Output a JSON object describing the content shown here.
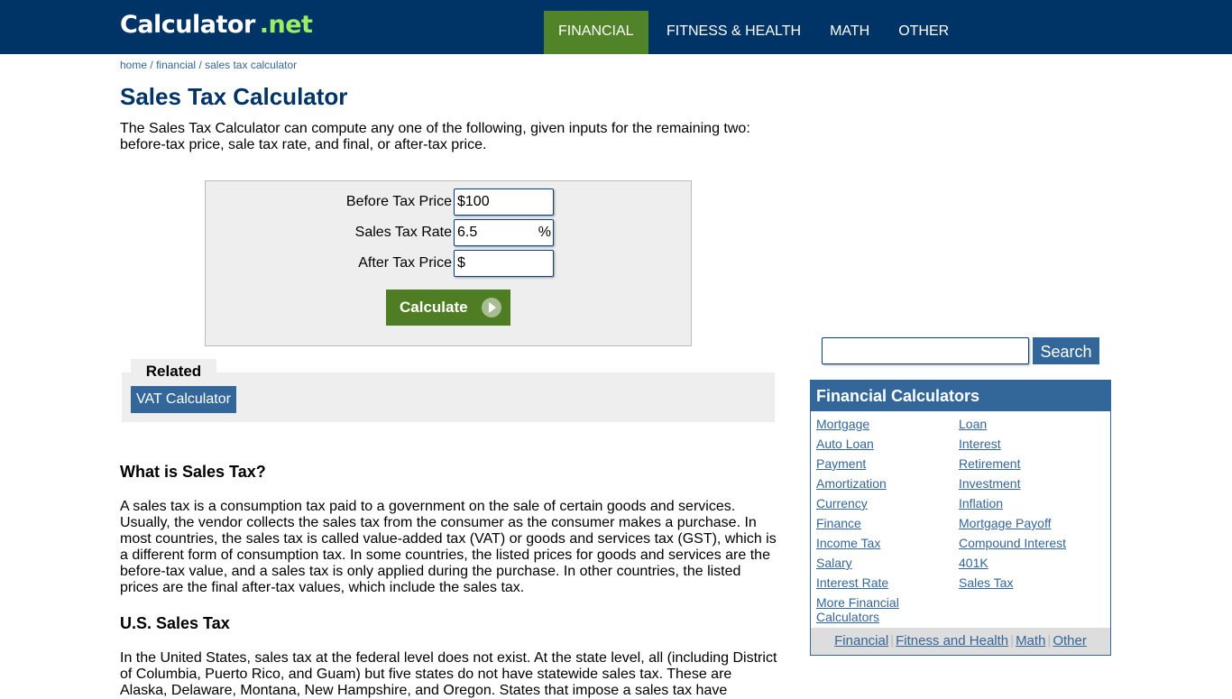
{
  "header": {
    "logo_main": "Calculator",
    "logo_suffix": ".net",
    "nav": [
      {
        "label": "FINANCIAL",
        "active": true
      },
      {
        "label": "FITNESS & HEALTH",
        "active": false
      },
      {
        "label": "MATH",
        "active": false
      },
      {
        "label": "OTHER",
        "active": false
      }
    ]
  },
  "breadcrumb": [
    "home",
    "financial",
    "sales tax calculator"
  ],
  "breadcrumb_sep": "/",
  "page": {
    "title": "Sales Tax Calculator",
    "intro": "The Sales Tax Calculator can compute any one of the following, given inputs for the remaining two: before-tax price, sale tax rate, and final, or after-tax price."
  },
  "calculator": {
    "fields": [
      {
        "label": "Before Tax Price",
        "value": "$100",
        "suffix": ""
      },
      {
        "label": "Sales Tax Rate",
        "value": "6.5",
        "suffix": "%"
      },
      {
        "label": "After Tax Price",
        "value": "$",
        "suffix": ""
      }
    ],
    "button_label": "Calculate"
  },
  "related": {
    "tab_label": "Related",
    "links": [
      "VAT Calculator"
    ]
  },
  "article": {
    "sections": [
      {
        "heading": "What is Sales Tax?",
        "text": "A sales tax is a consumption tax paid to a government on the sale of certain goods and services. Usually, the vendor collects the sales tax from the consumer as the consumer makes a purchase. In most countries, the sales tax is called value-added tax (VAT) or goods and services tax (GST), which is a different form of consumption tax. In some countries, the listed prices for goods and services are the before-tax value, and a sales tax is only applied during the purchase. In other countries, the listed prices are the final after-tax values, which include the sales tax."
      },
      {
        "heading": "U.S. Sales Tax",
        "text": "In the United States, sales tax at the federal level does not exist. At the state level, all (including District of Columbia, Puerto Rico, and Guam) but five states do not have statewide sales tax. These are Alaska, Delaware, Montana, New Hampshire, and Oregon. States that impose a sales tax have"
      }
    ]
  },
  "sidebar": {
    "search": {
      "value": "",
      "button_label": "Search"
    },
    "financial": {
      "title": "Financial Calculators",
      "col1": [
        "Mortgage",
        "Auto Loan",
        "Payment",
        "Amortization",
        "Currency",
        "Finance",
        "Income Tax",
        "Salary",
        "Interest Rate",
        "More Financial Calculators"
      ],
      "col2": [
        "Loan",
        "Interest",
        "Retirement",
        "Investment",
        "Inflation",
        "Mortgage Payoff",
        "Compound Interest",
        "401K",
        "Sales Tax"
      ],
      "footer": [
        "Financial",
        "Fitness and Health",
        "Math",
        "Other"
      ]
    }
  }
}
